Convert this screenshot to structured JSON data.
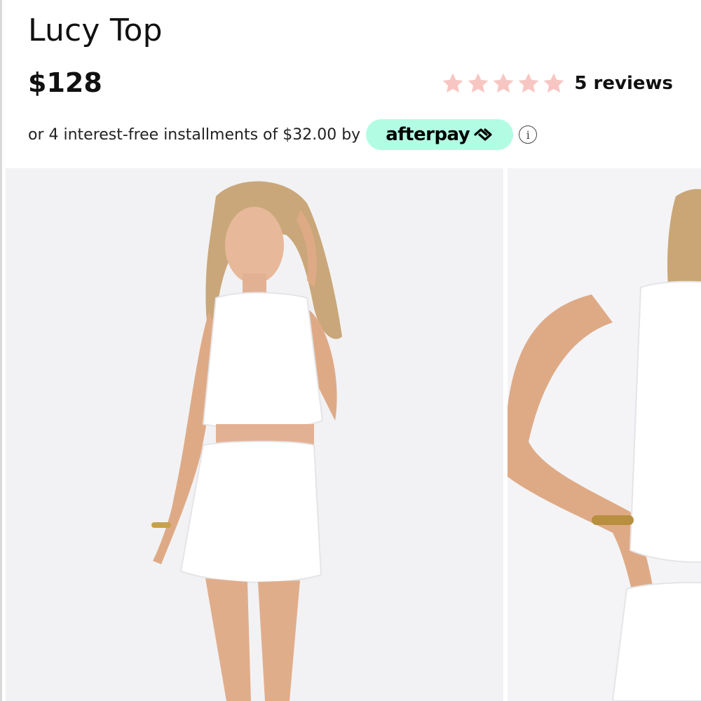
{
  "product": {
    "title": "Lucy Top",
    "price": "$128"
  },
  "rating": {
    "stars": 5,
    "max_stars": 5,
    "star_color": "#f7c6c3",
    "reviews_label": "5 reviews"
  },
  "installments": {
    "text": "or 4 interest-free installments of $32.00 by",
    "provider": "afterpay",
    "badge_color": "#b2fce4",
    "info_icon": "info-icon"
  },
  "gallery": {
    "images": [
      {
        "name": "product-photo-front",
        "description_icon": "photo"
      },
      {
        "name": "product-photo-side-closeup",
        "description_icon": "photo"
      }
    ]
  }
}
